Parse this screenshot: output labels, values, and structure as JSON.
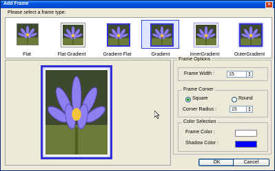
{
  "window": {
    "title": "Add Frame",
    "close_glyph": "×"
  },
  "prompt": "Please select a frame type:",
  "frame_types": [
    {
      "label": "Flat",
      "selected": false
    },
    {
      "label": "Flat-Gradient",
      "selected": false
    },
    {
      "label": "Gradient-Flat",
      "selected": false
    },
    {
      "label": "Gradient",
      "selected": true
    },
    {
      "label": "InnerGradient",
      "selected": false
    },
    {
      "label": "OuterGradient",
      "selected": false
    }
  ],
  "options": {
    "title": "Frame Options",
    "frame_width_label": "Frame Width :",
    "frame_width_value": "15",
    "corner_group_title": "Frame Corner",
    "square_label": "Square",
    "round_label": "Round",
    "selected_corner": "Square",
    "corner_radius_label": "Corner Radius :",
    "corner_radius_value": "15",
    "color_group_title": "Color Selection",
    "frame_color_label": "Frame Color :",
    "frame_color": "#ffffff",
    "shadow_color_label": "Shadow Color :",
    "shadow_color": "#0000ff"
  },
  "buttons": {
    "ok": "OK",
    "cancel": "Cancel"
  },
  "icons": {
    "close": "close-icon",
    "cursor": "mouse-pointer-icon",
    "spin": "up-down-arrow-icon"
  }
}
